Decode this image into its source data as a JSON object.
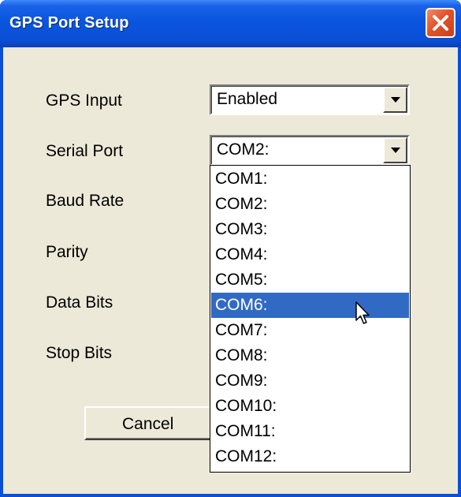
{
  "window": {
    "title": "GPS Port Setup",
    "close_icon": "close-icon"
  },
  "form": {
    "fields": [
      {
        "label": "GPS Input",
        "value": "Enabled"
      },
      {
        "label": "Serial Port",
        "value": "COM2:"
      },
      {
        "label": "Baud Rate",
        "value": ""
      },
      {
        "label": "Parity",
        "value": ""
      },
      {
        "label": "Data Bits",
        "value": ""
      },
      {
        "label": "Stop Bits",
        "value": ""
      }
    ],
    "cancel_label": "Cancel"
  },
  "dropdown": {
    "items": [
      "COM1:",
      "COM2:",
      "COM3:",
      "COM4:",
      "COM5:",
      "COM6:",
      "COM7:",
      "COM8:",
      "COM9:",
      "COM10:",
      "COM11:",
      "COM12:"
    ],
    "highlighted": "COM6:"
  },
  "colors": {
    "titlebar": "#0a55de",
    "dialog_bg": "#ece9d8",
    "selection": "#316ac5",
    "close_button": "#e2532b"
  }
}
